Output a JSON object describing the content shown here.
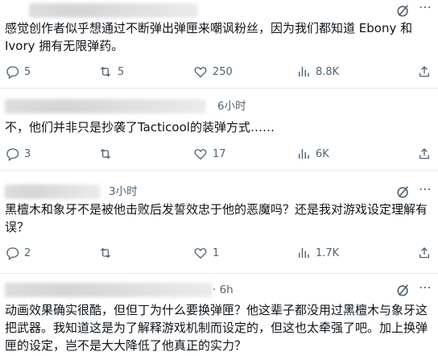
{
  "posts": [
    {
      "time": "",
      "text": "感觉创作者似乎想通过不断弹出弹匣来嘲讽粉丝，因为我们都知道 Ebony 和 Ivory 拥有无限弹药。",
      "replies": "5",
      "reposts": "5",
      "likes": "250",
      "views": "8.8K"
    },
    {
      "time": "6小时",
      "text": "不，他们并非只是抄袭了Tacticool的装弹方式……",
      "replies": "3",
      "reposts": "",
      "likes": "17",
      "views": "6K"
    },
    {
      "time": "3小时",
      "text": "黑檀木和象牙不是被他击败后发誓效忠于他的恶魔吗？还是我对游戏设定理解有误？",
      "replies": "2",
      "reposts": "",
      "likes": "1",
      "views": "1.7K"
    },
    {
      "time": "· 6h",
      "text": "动画效果确实很酷，但但丁为什么要换弹匣？他这辈子都没用过黑檀木与象牙这把武器。我知道这是为了解释游戏机制而设定的，但这也太牵强了吧。加上换弹匣的设定，岂不是大大降低了他真正的实力？"
    }
  ],
  "icons": {
    "grok": "slash-circle-icon",
    "reply": "reply-icon",
    "repost": "repost-icon",
    "like": "heart-icon",
    "views": "views-icon",
    "share": "share-icon",
    "more": "more-icon"
  },
  "colors": {
    "text": "#0f1419",
    "muted": "#536471",
    "divider": "#e6e9ec"
  }
}
